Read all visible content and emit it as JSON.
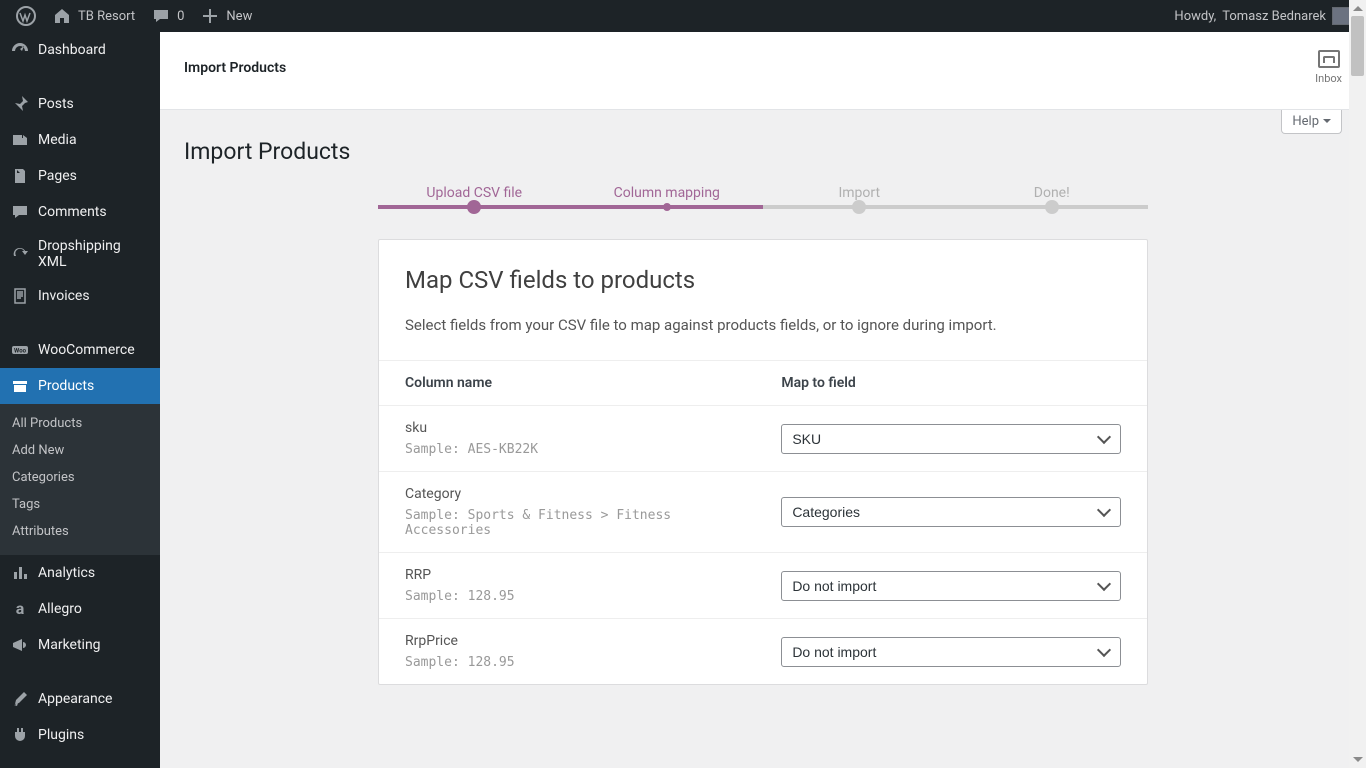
{
  "adminbar": {
    "site_name": "TB Resort",
    "comment_count": "0",
    "new_label": "New",
    "howdy_prefix": "Howdy, ",
    "user_name": "Tomasz Bednarek"
  },
  "sidebar": {
    "items": [
      {
        "label": "Dashboard",
        "icon": "dashboard-icon"
      },
      {
        "label": "Posts",
        "icon": "pin-icon"
      },
      {
        "label": "Media",
        "icon": "media-icon"
      },
      {
        "label": "Pages",
        "icon": "pages-icon"
      },
      {
        "label": "Comments",
        "icon": "comment-icon"
      },
      {
        "label": "Dropshipping XML",
        "icon": "refresh-icon"
      },
      {
        "label": "Invoices",
        "icon": "invoice-icon"
      },
      {
        "label": "WooCommerce",
        "icon": "woo-icon"
      },
      {
        "label": "Products",
        "icon": "archive-icon",
        "active": true
      },
      {
        "label": "Analytics",
        "icon": "chart-icon"
      },
      {
        "label": "Allegro",
        "icon": "allegro-icon"
      },
      {
        "label": "Marketing",
        "icon": "megaphone-icon"
      },
      {
        "label": "Appearance",
        "icon": "brush-icon"
      },
      {
        "label": "Plugins",
        "icon": "plug-icon"
      }
    ],
    "products_submenu": [
      "All Products",
      "Add New",
      "Categories",
      "Tags",
      "Attributes"
    ]
  },
  "header": {
    "breadcrumb": "Import Products",
    "inbox_label": "Inbox"
  },
  "page": {
    "title": "Import Products",
    "help_label": "Help"
  },
  "wizard": {
    "steps": [
      "Upload CSV file",
      "Column mapping",
      "Import",
      "Done!"
    ],
    "current_index": 1,
    "progress_percent": 50
  },
  "card": {
    "heading": "Map CSV fields to products",
    "description": "Select fields from your CSV file to map against products fields, or to ignore during import.",
    "th_column": "Column name",
    "th_field": "Map to field",
    "sample_prefix": "Sample:",
    "rows": [
      {
        "name": "sku",
        "sample": "AES-KB22K",
        "field": "SKU"
      },
      {
        "name": "Category",
        "sample": "Sports & Fitness > Fitness Accessories",
        "field": "Categories"
      },
      {
        "name": "RRP",
        "sample": "128.95",
        "field": "Do not import"
      },
      {
        "name": "RrpPrice",
        "sample": "128.95",
        "field": "Do not import"
      }
    ]
  }
}
